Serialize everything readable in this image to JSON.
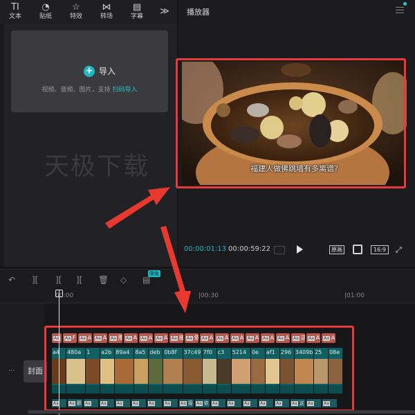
{
  "toolbar": {
    "tools": [
      {
        "icon": "TI",
        "label": "文本"
      },
      {
        "icon": "◔",
        "label": "贴纸"
      },
      {
        "icon": "☆",
        "label": "特效"
      },
      {
        "icon": "⋈",
        "label": "转场"
      },
      {
        "icon": "▤",
        "label": "字幕"
      }
    ],
    "more": "≫"
  },
  "media": {
    "import_label": "导入",
    "import_hint": "视频、音频、图片，支持",
    "import_link": "扫码导入",
    "watermark": "天极下载"
  },
  "player": {
    "title": "播放器",
    "subtitle": "福建人做佛跳墙有多离谱?",
    "current_time": "00:00:01:13",
    "total_time": "00:00:59:22",
    "original_btn": "原画",
    "ratio_btn": "16:9"
  },
  "timeline": {
    "badge": "限免",
    "ruler": [
      "00:00",
      "|00:30",
      "|01:00"
    ],
    "cover_label": "封面",
    "subtitle_clips": [
      "A",
      "F",
      "A",
      "A",
      "那",
      "A",
      "A",
      "A",
      "接",
      "依",
      "A",
      "A",
      "A",
      "A",
      "A",
      "A",
      "这",
      "A",
      "A"
    ],
    "video_clips": [
      "a4",
      "480a",
      "1",
      "a2b",
      "89a4",
      "8a5",
      "deb",
      "0b8f",
      "37c49",
      "7f0",
      "c3",
      "5214",
      "0e",
      "af1",
      "296",
      "3409ba",
      "25",
      "08e"
    ],
    "audio_clips": [
      "那",
      "接",
      "依",
      "这"
    ]
  },
  "colors": {
    "accent": "#2bc2cd",
    "highlight": "#e83a3a",
    "subtitle_clip": "#b7584f",
    "video_clip": "#0f5f63"
  }
}
